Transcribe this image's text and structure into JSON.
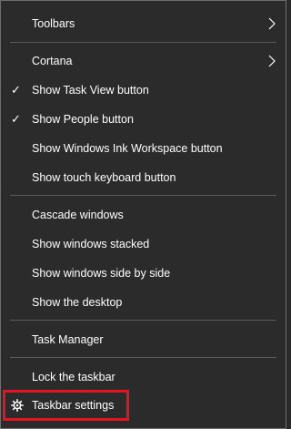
{
  "menu": {
    "toolbars": "Toolbars",
    "cortana": "Cortana",
    "show_task_view": "Show Task View button",
    "show_people": "Show People button",
    "show_ink": "Show Windows Ink Workspace button",
    "show_touch_keyboard": "Show touch keyboard button",
    "cascade": "Cascade windows",
    "stacked": "Show windows stacked",
    "side_by_side": "Show windows side by side",
    "show_desktop": "Show the desktop",
    "task_manager": "Task Manager",
    "lock_taskbar": "Lock the taskbar",
    "taskbar_settings": "Taskbar settings",
    "check_glyph": "✓"
  },
  "checked": {
    "show_task_view": true,
    "show_people": true
  },
  "icons": {
    "submenu": "chevron-right-icon",
    "settings": "gear-icon",
    "checked": "checkmark-icon"
  },
  "colors": {
    "menu_bg": "#2b2b2b",
    "text": "#ffffff",
    "separator": "#5a5a5a",
    "highlight_box": "#e3141f"
  }
}
